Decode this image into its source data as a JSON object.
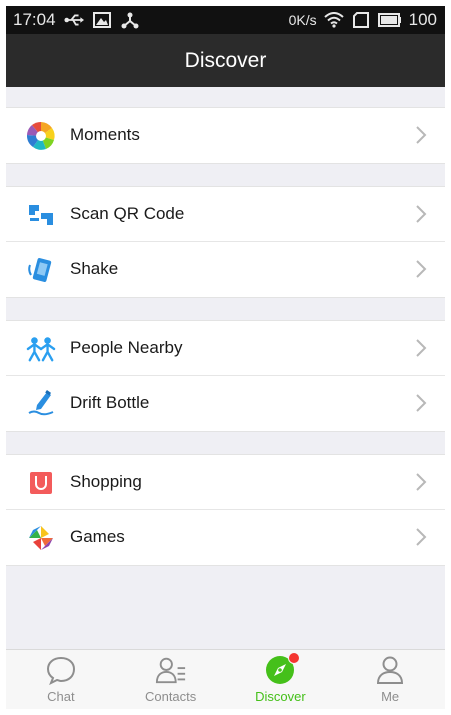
{
  "status_bar": {
    "time": "17:04",
    "network": "0K/s",
    "battery": "100",
    "icons": [
      "usb-icon",
      "image-icon",
      "share-icon",
      "wifi-icon",
      "sim-icon",
      "battery-icon"
    ]
  },
  "header": {
    "title": "Discover"
  },
  "groups": [
    {
      "items": [
        {
          "label": "Moments",
          "icon": "moments-icon"
        }
      ]
    },
    {
      "items": [
        {
          "label": "Scan QR Code",
          "icon": "scan-qr-icon"
        },
        {
          "label": "Shake",
          "icon": "shake-icon"
        }
      ]
    },
    {
      "items": [
        {
          "label": "People Nearby",
          "icon": "people-nearby-icon"
        },
        {
          "label": "Drift Bottle",
          "icon": "drift-bottle-icon"
        }
      ]
    },
    {
      "items": [
        {
          "label": "Shopping",
          "icon": "shopping-icon"
        },
        {
          "label": "Games",
          "icon": "games-icon"
        }
      ]
    }
  ],
  "tabs": [
    {
      "label": "Chat",
      "icon": "chat-icon"
    },
    {
      "label": "Contacts",
      "icon": "contacts-icon"
    },
    {
      "label": "Discover",
      "icon": "compass-icon",
      "active": true
    },
    {
      "label": "Me",
      "icon": "person-icon"
    }
  ],
  "colors": {
    "accent": "#45c01a",
    "title_bar": "#2b2b2b",
    "badge": "#f43530",
    "background": "#efeff4"
  }
}
